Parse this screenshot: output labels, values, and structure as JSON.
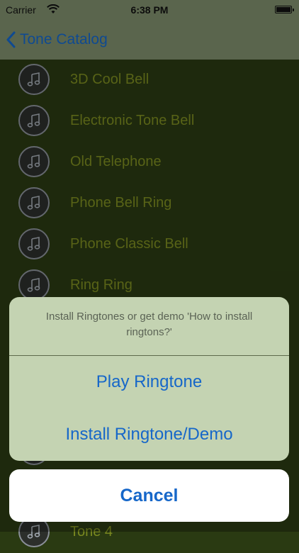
{
  "status_bar": {
    "carrier": "Carrier",
    "time": "6:38 PM"
  },
  "nav": {
    "back_label": "Tone Catalog"
  },
  "tones": [
    "3D Cool Bell",
    "Electronic Tone Bell",
    "Old Telephone",
    "Phone Bell Ring",
    "Phone Classic Bell",
    "Ring Ring",
    "",
    "",
    "",
    "",
    "",
    "Tone 4"
  ],
  "action_sheet": {
    "message": "Install Ringtones or get demo 'How to install ringtons?'",
    "actions": [
      "Play Ringtone",
      "Install Ringtone/Demo"
    ],
    "cancel": "Cancel"
  },
  "colors": {
    "accent": "#1667c9",
    "list_background": "#2a3a12",
    "row_text": "#7b8a20",
    "sheet_background": "#c4d3b2"
  },
  "icons": {
    "row_icon": "music-note-icon",
    "back_icon": "chevron-left-icon"
  }
}
